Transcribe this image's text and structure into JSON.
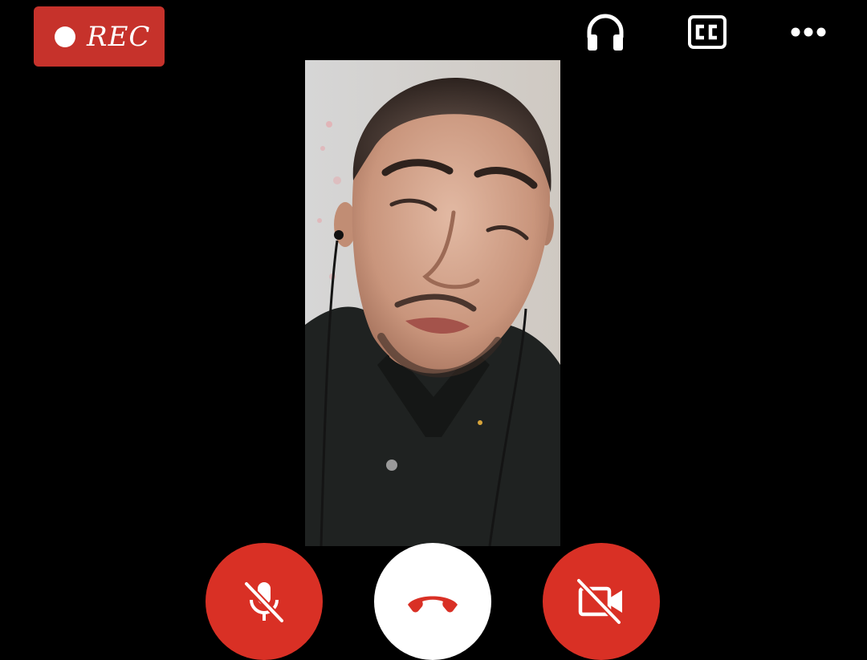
{
  "recording": {
    "label": "REC",
    "color": "#c6322b"
  },
  "top_bar": {
    "icons": [
      "headphones-icon",
      "closed-captions-icon",
      "more-options-icon"
    ],
    "cc_text": "CC"
  },
  "video": {
    "description_icon": "remote-participant-video"
  },
  "controls": {
    "mute": {
      "icon": "mic-off-icon",
      "color": "#d93025"
    },
    "end_call": {
      "icon": "end-call-icon",
      "color": "#d93025",
      "background": "#ffffff"
    },
    "camera": {
      "icon": "camera-off-icon",
      "color": "#d93025"
    }
  }
}
